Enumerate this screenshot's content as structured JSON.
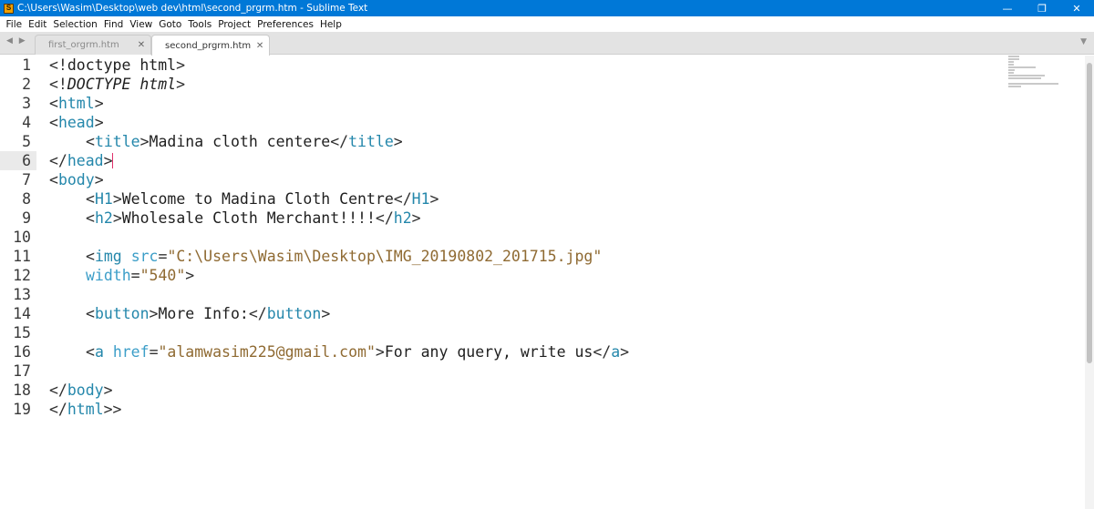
{
  "window": {
    "title": "C:\\Users\\Wasim\\Desktop\\web dev\\html\\second_prgrm.htm - Sublime Text",
    "app_icon": "sublime-text-icon",
    "minimize": "—",
    "maximize": "❐",
    "close": "✕"
  },
  "menu": {
    "file": "File",
    "edit": "Edit",
    "selection": "Selection",
    "find": "Find",
    "view": "View",
    "goto": "Goto",
    "tools": "Tools",
    "project": "Project",
    "preferences": "Preferences",
    "help": "Help"
  },
  "tabs": {
    "nav": "◀ ▶",
    "inactive_label": "first_orgrm.htm",
    "active_label": "second_prgrm.htm",
    "close": "✕",
    "dropdown": "▼"
  },
  "editor": {
    "current_line": 6,
    "line_numbers": [
      "1",
      "2",
      "3",
      "4",
      "5",
      "6",
      "7",
      "8",
      "9",
      "10",
      "11",
      "12",
      "13",
      "14",
      "15",
      "16",
      "17",
      "18",
      "19"
    ],
    "l1": {
      "open": "<!",
      "word": "doctype",
      "rest": " html",
      "close": ">"
    },
    "l2": {
      "open": "<!",
      "word": "DOCTYPE html",
      "close": ">"
    },
    "l3": {
      "open": "<",
      "tag": "html",
      "close": ">"
    },
    "l4": {
      "open": "<",
      "tag": "head",
      "close": ">"
    },
    "l5": {
      "open": "<",
      "tag": "title",
      "close": ">",
      "text": "Madina cloth centere",
      "end_open": "</",
      "end_tag": "title",
      "end_close": ">"
    },
    "l6": {
      "open": "</",
      "tag": "head",
      "close": ">"
    },
    "l7": {
      "open": "<",
      "tag": "body",
      "close": ">"
    },
    "l8": {
      "open": "<",
      "tag": "H1",
      "close": ">",
      "text": "Welcome to Madina Cloth Centre",
      "end_open": "</",
      "end_tag": "H1",
      "end_close": ">"
    },
    "l9": {
      "open": "<",
      "tag": "h2",
      "close": ">",
      "text": "Wholesale Cloth Merchant!!!!",
      "end_open": "</",
      "end_tag": "h2",
      "end_close": ">"
    },
    "l11": {
      "open": "<",
      "tag": "img",
      "attr": "src",
      "eq": "=",
      "value": "\"C:\\Users\\Wasim\\Desktop\\IMG_20190802_201715.jpg\""
    },
    "l12": {
      "attr": "width",
      "eq": "=",
      "value": "\"540\"",
      "close": ">"
    },
    "l14": {
      "open": "<",
      "tag": "button",
      "close": ">",
      "text": "More Info:",
      "end_open": "</",
      "end_tag": "button",
      "end_close": ">"
    },
    "l16": {
      "open": "<",
      "tag": "a",
      "attr": "href",
      "eq": "=",
      "value": "\"alamwasim225@gmail.com\"",
      "close": ">",
      "text": "For any query, write us",
      "end_open": "</",
      "end_tag": "a",
      "end_close": ">"
    },
    "l18": {
      "open": "</",
      "tag": "body",
      "close": ">"
    },
    "l19": {
      "open": "</",
      "tag": "html",
      "close": ">>"
    }
  },
  "colors": {
    "titlebar": "#0078d7",
    "tag": "#2487ab",
    "attribute": "#3c9ec8",
    "string": "#8f6a32",
    "cursor": "#e0306a"
  }
}
